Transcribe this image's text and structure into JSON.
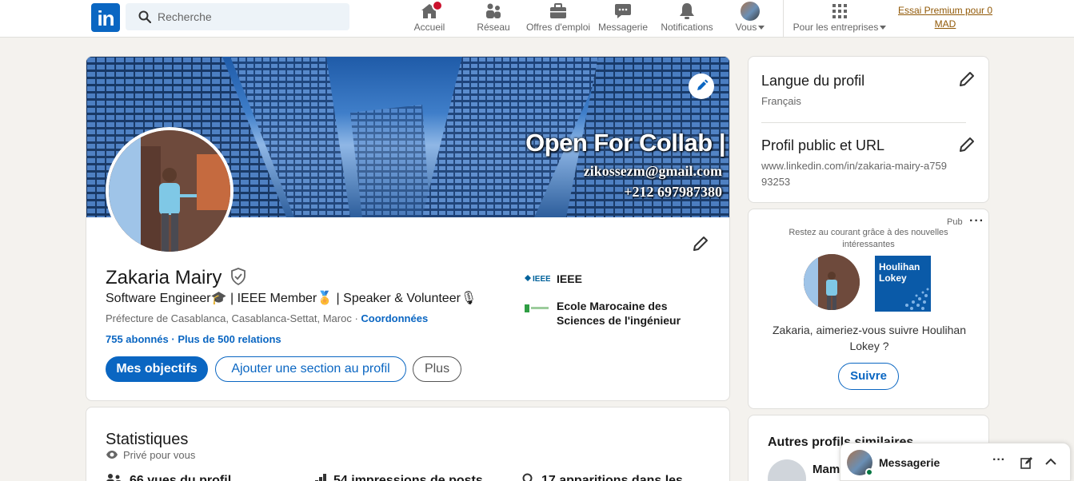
{
  "search": {
    "placeholder": "Recherche"
  },
  "nav": {
    "home": "Accueil",
    "network": "Réseau",
    "jobs": "Offres d'emploi",
    "messaging": "Messagerie",
    "notifications": "Notifications",
    "me": "Vous",
    "business": "Pour les entreprises",
    "premium": "Essai Premium pour 0 MAD"
  },
  "cover": {
    "title": "Open For Collab |",
    "email": "zikossezm@gmail.com",
    "phone": "+212 697987380"
  },
  "profile": {
    "name": "Zakaria Mairy",
    "headline": "Software Engineer🎓 | IEEE Member🏅 | Speaker & Volunteer🎙",
    "location": "Préfecture de Casablanca, Casablanca-Settat, Maroc · ",
    "contact_link": "Coordonnées",
    "followers": "755 abonnés",
    "connections": " · Plus de 500 relations",
    "btn_goals": "Mes objectifs",
    "btn_add_section": "Ajouter une section au profil",
    "btn_more": "Plus",
    "experiences": [
      {
        "name": "IEEE"
      },
      {
        "name": "Ecole Marocaine des Sciences de l'ingénieur"
      }
    ]
  },
  "stats": {
    "title": "Statistiques",
    "privacy": "Privé pour vous",
    "items": [
      "66 vues du profil",
      "54 impressions de posts",
      "17 apparitions dans les"
    ]
  },
  "right": {
    "lang_title": "Langue du profil",
    "lang_value": "Français",
    "url_title": "Profil public et URL",
    "url_value": "www.linkedin.com/in/zakaria-mairy-a75993253",
    "ad_label": "Pub",
    "ad_text": "Restez au courant grâce à des nouvelles intéressantes",
    "ad_company": "Houlihan Lokey",
    "ad_question": "Zakaria, aimeriez-vous suivre Houlihan Lokey ?",
    "ad_follow": "Suivre",
    "similar_title": "Autres profils similaires",
    "similar_first": "Mam"
  },
  "messaging": {
    "label": "Messagerie"
  },
  "colors": {
    "brand": "#0a66c2",
    "premium": "#915907",
    "badge": "#cb112d"
  }
}
